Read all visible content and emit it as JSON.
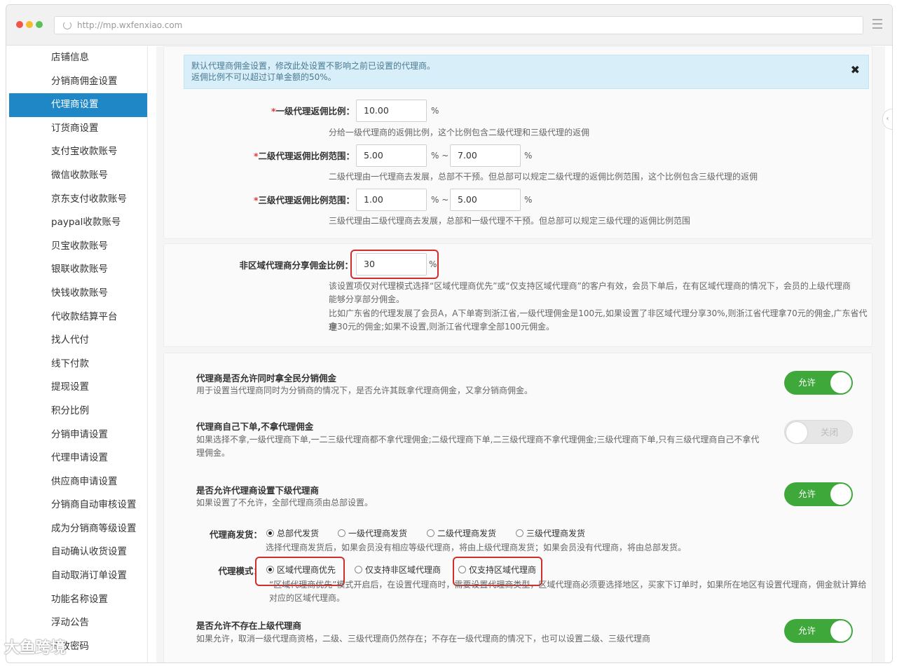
{
  "browser": {
    "url": "http://mp.wxfenxiao.com",
    "colors": {
      "red": "#f0554a",
      "yellow": "#f4bc2f",
      "green": "#5ac05a"
    }
  },
  "sidebar": {
    "items": [
      {
        "label": "店铺信息"
      },
      {
        "label": "分销商佣金设置"
      },
      {
        "label": "代理商设置",
        "active": true
      },
      {
        "label": "订货商设置"
      },
      {
        "label": "支付宝收款账号"
      },
      {
        "label": "微信收款账号"
      },
      {
        "label": "京东支付收款账号"
      },
      {
        "label": "paypal收款账号"
      },
      {
        "label": "贝宝收款账号"
      },
      {
        "label": "银联收款账号"
      },
      {
        "label": "快钱收款账号"
      },
      {
        "label": "代收款结算平台"
      },
      {
        "label": "找人代付"
      },
      {
        "label": "线下付款"
      },
      {
        "label": "提现设置"
      },
      {
        "label": "积分比例"
      },
      {
        "label": "分销申请设置"
      },
      {
        "label": "代理申请设置"
      },
      {
        "label": "供应商申请设置"
      },
      {
        "label": "分销商自动审核设置"
      },
      {
        "label": "成为分销商等级设置"
      },
      {
        "label": "自动确认收货设置"
      },
      {
        "label": "自动取消订单设置"
      },
      {
        "label": "功能名称设置"
      },
      {
        "label": "浮动公告"
      },
      {
        "label": "修改密码"
      }
    ]
  },
  "notice": {
    "line1": "默认代理商佣金设置，修改此处设置不影响之前已设置的代理商。",
    "line2": "返佣比例不可以超过订单金额的50%。",
    "close": "✖"
  },
  "rebate": {
    "level1": {
      "label": "一级代理返佣比例：",
      "value": "10.00",
      "unit": "%",
      "hint": "分给一级代理商的返佣比例，这个比例包含二级代理和三级代理的返佣"
    },
    "level2": {
      "label": "二级代理返佣比例范围：",
      "min": "5.00",
      "max": "7.00",
      "sep": "% ~",
      "unit": "%",
      "hint": "二级代理由一代理商去发展，总部不干预。但总部可以规定二级代理的返佣比例范围，这个比例包含三级代理的返佣"
    },
    "level3": {
      "label": "三级代理返佣比例范围：",
      "min": "1.00",
      "max": "5.00",
      "sep": "% ~",
      "unit": "%",
      "hint": "三级代理由二级代理商去发展，总部和一级代理不干预。但总部可以规定三级代理的返佣比例范围"
    },
    "required_mark": "*"
  },
  "nonregional": {
    "label": "非区域代理商分享佣金比例：",
    "value": "30",
    "unit": "%",
    "desc1": "该设置项仅对代理模式选择“区域代理商优先”或“仅支持区域代理商”的客户有效，会员下单后，在有区域代理商的情况下，会员的上级代理商",
    "desc2": "能够分享部分佣金。",
    "desc3": "比如广东省的代理发展了会员A，A下单寄到浙江省,一级代理佣金是100元,如果设置了非区域代理分享30%,则浙江省代理拿70元的佣金,广东省代理",
    "desc4": "拿30元的佣金;如果不设置,则浙江省代理拿全部100元佣金。"
  },
  "settings": {
    "both_commission": {
      "title": "代理商是否允许同时拿全民分销佣金",
      "desc": "用于设置当代理商同时为分销商的情况下，是否允许其既拿代理商佣金，又拿分销商佣金。",
      "toggle": "允许"
    },
    "self_order": {
      "title": "代理商自己下单,不拿代理佣金",
      "desc1": "如果选择不拿,一级代理商下单,一二三级代理商都不拿代理佣金;二级代理商下单,二三级代理商不拿代理佣金;三级代理商下单,只有三级代理商自己不拿代",
      "desc2": "理佣金。",
      "toggle": "关闭"
    },
    "sub_agent": {
      "title": "是否允许代理商设置下级代理商",
      "desc": "如果设置了不允许，全部代理商须由总部设置。",
      "toggle": "允许"
    },
    "shipping": {
      "label": "代理商发货：",
      "options": [
        "总部代发货",
        "一级代理商发货",
        "二级代理商发货",
        "三级代理商发货"
      ],
      "hint": "选择代理商发货后，如果会员没有相应等级代理商，将由上级代理商发货；如果会员没有代理商，将由总部发货。"
    },
    "mode": {
      "label": "代理模式：",
      "options": [
        "区域代理商优先",
        "仅支持非区域代理商",
        "仅支持区域代理商"
      ],
      "hint1": "“区域代理商优先”模式开启后，在设置代理商时，需要设置代理商类型，区域代理商必须要选择地区，买家下订单时，如果所在地区有设置代理商，佣金就计算给",
      "hint2": "对应的区域代理商。"
    },
    "no_superior": {
      "title": "是否允许不存在上级代理商",
      "desc": "如果允许，取消一级代理商资格，二级、三级代理商仍然存在；不存在一级代理商的情况下，也可以设置二级、三级代理商",
      "toggle": "允许"
    }
  },
  "watermark": "大鱼跨境"
}
